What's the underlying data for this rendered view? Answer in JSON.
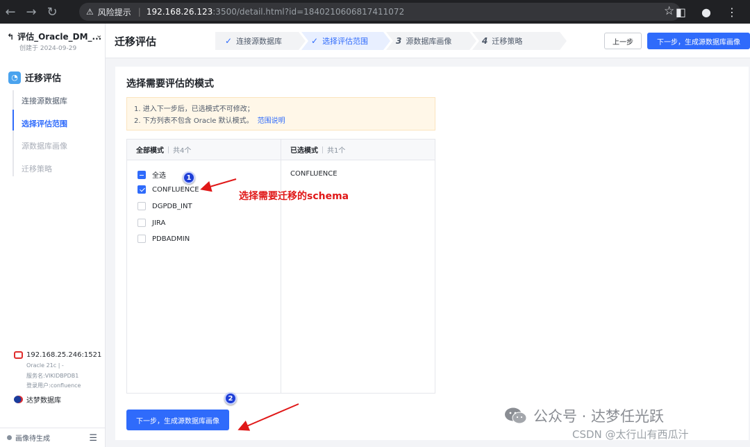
{
  "browser": {
    "risk_label": "风险提示",
    "host": "192.168.26.123",
    "path": ":3500/detail.html?id=1840210606817411072"
  },
  "sidebar": {
    "project_name": "评估_Oracle_DM_...",
    "created": "创建于 2024-09-29",
    "module_title": "迁移评估",
    "items": [
      {
        "label": "连接源数据库"
      },
      {
        "label": "选择评估范围"
      },
      {
        "label": "源数据库画像"
      },
      {
        "label": "迁移策略"
      }
    ],
    "source": {
      "ip": "192.168.25.246:1521",
      "version": "Oracle 21c | -",
      "service": "服务名:VIKIDBPDB1",
      "user": "登录用户:confluence"
    },
    "target": "达梦数据库",
    "footer_status": "画像待生成"
  },
  "header": {
    "title": "迁移评估",
    "steps": [
      {
        "label": "连接源数据库"
      },
      {
        "label": "选择评估范围"
      },
      {
        "num": "3",
        "label": "源数据库画像"
      },
      {
        "num": "4",
        "label": "迁移策略"
      }
    ],
    "prev_label": "上一步",
    "next_label": "下一步，生成源数据库画像"
  },
  "main": {
    "section_title": "选择需要评估的模式",
    "notice_1": "1. 进入下一步后，已选模式不可修改；",
    "notice_2": "2. 下方列表不包含 Oracle 默认模式。",
    "notice_link": "范围说明",
    "left_panel": {
      "title": "全部模式",
      "count": "共4个",
      "select_all": "全选",
      "schemas": [
        "CONFLUENCE",
        "DGPDB_INT",
        "JIRA",
        "PDBADMIN"
      ]
    },
    "right_panel": {
      "title": "已选模式",
      "count": "共1个",
      "schemas": [
        "CONFLUENCE"
      ]
    },
    "next_button": "下一步，生成源数据库画像"
  },
  "annotations": {
    "badge_1": "1",
    "badge_2": "2",
    "note": "选择需要迁移的schema"
  },
  "watermark": {
    "line1": "公众号 · 达梦任光跃",
    "line2": "CSDN @太行山有西瓜汁"
  }
}
